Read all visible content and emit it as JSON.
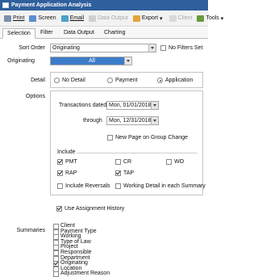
{
  "window": {
    "title": "Payment Application Analysis"
  },
  "toolbar": {
    "print": "Print",
    "screen": "Screen",
    "email": "Email",
    "data_output": "Data Output",
    "export": "Export",
    "client": "Client",
    "tools": "Tools"
  },
  "tabs": [
    "Selection",
    "Filter",
    "Data Output",
    "Charting"
  ],
  "form": {
    "sort_order_label": "Sort Order",
    "sort_order_value": "Originating",
    "no_filters": "No Filters Set",
    "originating_label": "Originating",
    "originating_value": "All",
    "detail_label": "Detail",
    "detail_options": [
      "No Detail",
      "Payment",
      "Application"
    ],
    "detail_selected": "Application",
    "options_label": "Options",
    "transactions_dated_label": "Transactions dated",
    "date_from": "Mon, 01/01/2018",
    "through_label": "through",
    "date_to": "Mon, 12/31/2018",
    "new_page_on_group_change": "New Page on Group Change",
    "include_label": "Include",
    "include": [
      {
        "label": "PMT",
        "checked": true
      },
      {
        "label": "CR",
        "checked": false
      },
      {
        "label": "WO",
        "checked": false
      },
      {
        "label": "RAP",
        "checked": true
      },
      {
        "label": "TAP",
        "checked": true
      }
    ],
    "include_reversals": "Include Reversals",
    "working_detail": "Working Detail in each Summary",
    "use_assignment_history": "Use Assignment History",
    "summaries_label": "Summaries",
    "summaries": [
      {
        "label": "Client",
        "checked": false
      },
      {
        "label": "Payment Type",
        "checked": false
      },
      {
        "label": "Working",
        "checked": false
      },
      {
        "label": "Type of Law",
        "checked": false
      },
      {
        "label": "Project",
        "checked": false
      },
      {
        "label": "Responsible",
        "checked": false
      },
      {
        "label": "Department",
        "checked": false
      },
      {
        "label": "Originating",
        "checked": true
      },
      {
        "label": "Location",
        "checked": false
      },
      {
        "label": "Adjustment Reason",
        "checked": false
      }
    ]
  }
}
